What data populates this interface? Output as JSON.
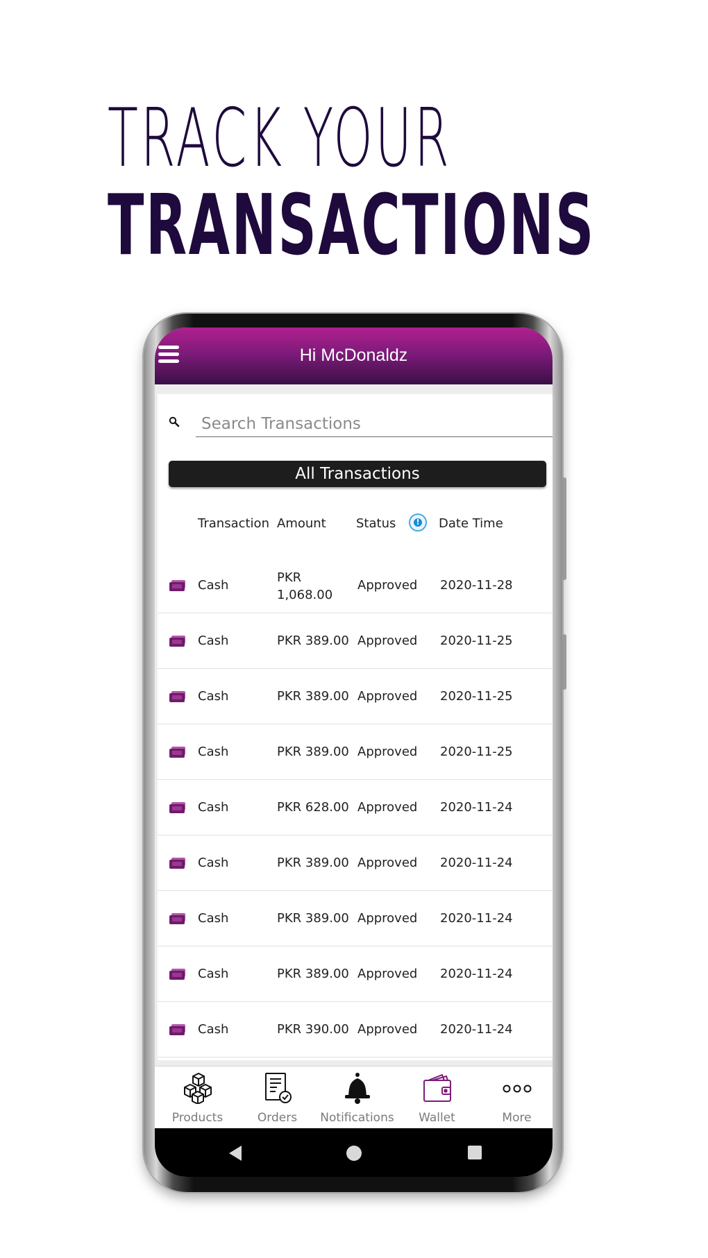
{
  "headline": {
    "line1": "TRACK YOUR",
    "line2": "TRANSACTIONS"
  },
  "app": {
    "title": "Hi McDonaldz",
    "search_placeholder": "Search Transactions",
    "filter_label": "All Transactions",
    "columns": {
      "transaction": "Transaction",
      "amount": "Amount",
      "status": "Status",
      "datetime": "Date Time"
    },
    "rows": [
      {
        "type": "Cash",
        "amount": "PKR 1,068.00",
        "status": "Approved",
        "date": "2020-11-28"
      },
      {
        "type": "Cash",
        "amount": "PKR 389.00",
        "status": "Approved",
        "date": "2020-11-25"
      },
      {
        "type": "Cash",
        "amount": "PKR 389.00",
        "status": "Approved",
        "date": "2020-11-25"
      },
      {
        "type": "Cash",
        "amount": "PKR 389.00",
        "status": "Approved",
        "date": "2020-11-25"
      },
      {
        "type": "Cash",
        "amount": "PKR 628.00",
        "status": "Approved",
        "date": "2020-11-24"
      },
      {
        "type": "Cash",
        "amount": "PKR 389.00",
        "status": "Approved",
        "date": "2020-11-24"
      },
      {
        "type": "Cash",
        "amount": "PKR 389.00",
        "status": "Approved",
        "date": "2020-11-24"
      },
      {
        "type": "Cash",
        "amount": "PKR 389.00",
        "status": "Approved",
        "date": "2020-11-24"
      },
      {
        "type": "Cash",
        "amount": "PKR 390.00",
        "status": "Approved",
        "date": "2020-11-24"
      }
    ],
    "nav": [
      {
        "label": "Products",
        "icon": "boxes-icon"
      },
      {
        "label": "Orders",
        "icon": "orders-icon"
      },
      {
        "label": "Notifications",
        "icon": "bell-icon"
      },
      {
        "label": "Wallet",
        "icon": "wallet-icon"
      },
      {
        "label": "More",
        "icon": "more-dots-icon"
      }
    ]
  },
  "colors": {
    "headline": "#1e0a3c",
    "header_top": "#b0208f",
    "header_bottom": "#3a0f46",
    "accent_purple": "#7e1b7a",
    "filter_bg": "#1d1d1d",
    "info_blue": "#1a8bd6"
  }
}
